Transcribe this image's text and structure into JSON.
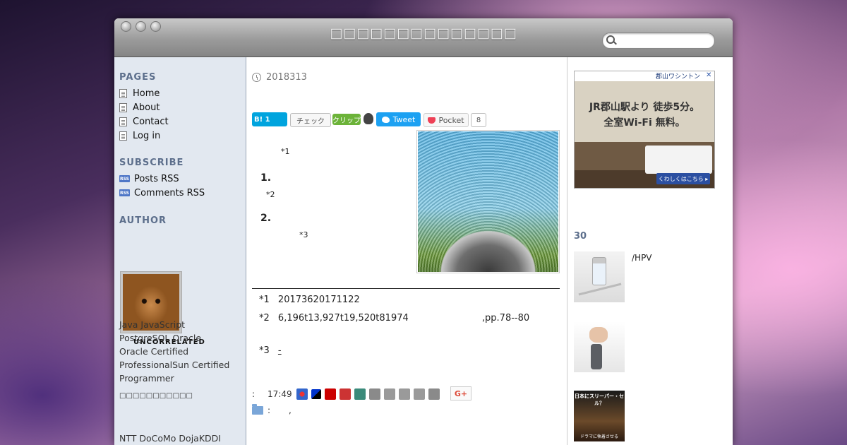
{
  "window": {
    "title": "□□□□□□□□□□□□□□",
    "search": {
      "placeholder": "",
      "value": ""
    }
  },
  "sidebar": {
    "pages_heading": "PAGES",
    "pages": [
      {
        "label": "Home"
      },
      {
        "label": "About"
      },
      {
        "label": "Contact"
      },
      {
        "label": "Log in"
      }
    ],
    "subscribe_heading": "SUBSCRIBE",
    "subscribe": [
      {
        "icon": "rss-icon",
        "label": "Posts RSS"
      },
      {
        "icon": "rss-icon",
        "label": "Comments RSS"
      }
    ],
    "author_heading": "AUTHOR",
    "author_name": "UNCORRELATED",
    "bio_lines": [
      "Java JavaScript",
      "PostgreSQL Oracle",
      "Oracle Certified",
      "ProfessionalSun Certified",
      "Programmer",
      "□□□□□□□□□□□",
      "NTT DoCoMo DojaKDDI"
    ]
  },
  "post": {
    "date": "2018313",
    "share": {
      "hatena_label": "B! 1",
      "check_label": "チェック",
      "clip_label": "クリップ",
      "tweet_label": "Tweet",
      "pocket_label": "Pocket",
      "pocket_count": "8"
    },
    "body": {
      "ref1": "*1",
      "item1": "1.",
      "ref2": "*2",
      "item2": "2.",
      "ref3": "*3"
    },
    "footnotes": [
      {
        "num": "*1",
        "text": "20173620171122"
      },
      {
        "num": "*2",
        "text": "6,196t13,927t19,520t81974",
        "tail": ",pp.78--80"
      },
      {
        "num": "*3",
        "text": "-"
      }
    ],
    "meta": {
      "prefix": ":",
      "time": "17:49",
      "category_prefix": ":",
      "category_sep": ","
    },
    "gplus_label": "G+"
  },
  "right": {
    "ad": {
      "brand": "郡山ワシントン",
      "line1": "JR郡山駅より 徒歩5分。",
      "line2": "全室Wi-Fi 無料。",
      "button": "くわしくはこちら ▸"
    },
    "popular_heading": "30",
    "popular": [
      {
        "title": "/HPV",
        "icon": "vaccine-thumb"
      },
      {
        "title": "",
        "icon": "device-thumb"
      },
      {
        "title": "",
        "icon": "movie-thumb",
        "caption_top": "日本にスリーパー・セル？",
        "caption_bottom": "ドラマに執着させる"
      }
    ]
  }
}
